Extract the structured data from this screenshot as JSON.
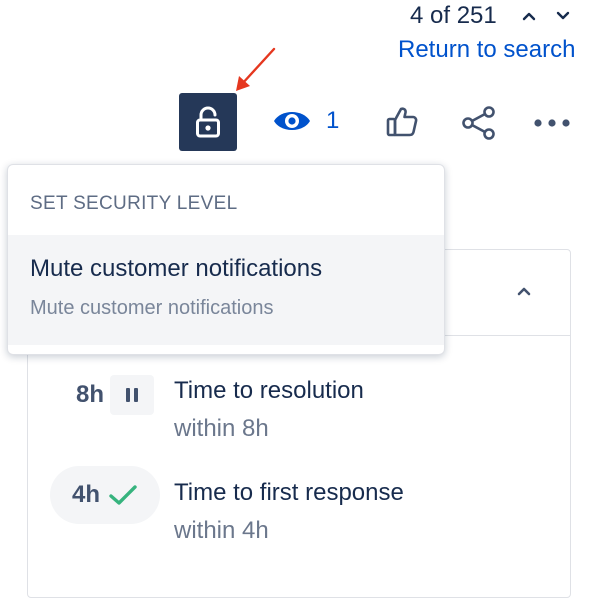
{
  "pager": {
    "position_text": "4 of 251",
    "return_link": "Return to search"
  },
  "toolbar": {
    "security_icon": "unlock-icon",
    "watch_icon": "eye-icon",
    "watch_count": "1",
    "like_icon": "thumbs-up-icon",
    "share_icon": "share-icon",
    "more_icon": "more-horizontal-icon"
  },
  "security_menu": {
    "heading": "SET SECURITY LEVEL",
    "items": [
      {
        "title": "Mute customer notifications",
        "description": "Mute customer notifications"
      }
    ]
  },
  "sla": {
    "items": [
      {
        "time": "8h",
        "status_icon": "pause-icon",
        "title": "Time to resolution",
        "subtitle": "within 8h"
      },
      {
        "time": "4h",
        "status_icon": "check-icon",
        "title": "Time to first response",
        "subtitle": "within 4h"
      }
    ]
  },
  "colors": {
    "link": "#0052cc",
    "lock_button_bg": "#253858",
    "check": "#36b37e",
    "annotation_arrow": "#e5371f"
  }
}
